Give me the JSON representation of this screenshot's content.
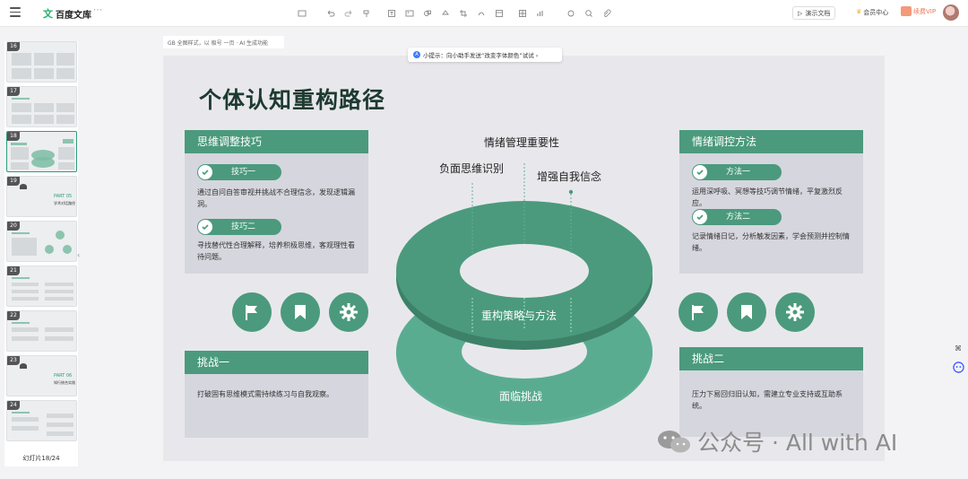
{
  "app": {
    "brand_logo": "文",
    "brand_name": "百度文库",
    "more": "⋯"
  },
  "header": {
    "present_label": "演示文档",
    "member_label": "会员中心",
    "vip_label": "续费VIP"
  },
  "toolbar": {
    "icons": [
      "image-icon",
      "undo-icon",
      "redo-icon",
      "format-painter-icon",
      "text-box-icon",
      "picture-icon",
      "shape-icon",
      "fill-icon",
      "crop-icon",
      "link-shape-icon",
      "layout-icon",
      "table-icon",
      "chart-icon",
      "more-tools-icon",
      "zoom-fit-icon",
      "search-icon",
      "attachment-icon"
    ]
  },
  "top_note": "GB 全图样式，以 极号 一页 · AI 生成功能",
  "tip": {
    "icon": "A",
    "text": "小提示：向小助手发送“改变字体颜色”试试 ›"
  },
  "sidebar": {
    "thumbs": [
      {
        "num": "16"
      },
      {
        "num": "17"
      },
      {
        "num": "18"
      },
      {
        "num": "19",
        "part": "PART  05",
        "part_sub": "学术对话路径"
      },
      {
        "num": "20"
      },
      {
        "num": "21"
      },
      {
        "num": "22"
      },
      {
        "num": "23",
        "part": "PART  06",
        "part_sub": "知行统合实践"
      },
      {
        "num": "24"
      }
    ],
    "slide_counter": "幻灯片18/24",
    "collapse": "‹"
  },
  "slide": {
    "title": "个体认知重构路径",
    "left_card": {
      "head": "思维调整技巧",
      "pill1": "技巧一",
      "text1": "通过自问自答审视并挑战不合理信念，发现逻辑漏洞。",
      "pill2": "技巧二",
      "text2": "寻找替代性合理解释，培养积极思维，客观理性看待问题。"
    },
    "right_card": {
      "head": "情绪调控方法",
      "pill1": "方法一",
      "text1": "运用深呼吸、冥想等技巧调节情绪，平复激烈反应。",
      "pill2": "方法二",
      "text2": "记录情绪日记，分析触发因素，学会预测并控制情绪。"
    },
    "challenge1": {
      "head": "挑战一",
      "text": "打破固有思维模式需持续练习与自我观察。"
    },
    "challenge2": {
      "head": "挑战二",
      "text": "压力下易回归旧认知，需建立专业支持或互助系统。"
    },
    "center": {
      "top_label": "情绪管理重要性",
      "left_label": "负面思维识别",
      "right_label": "增强自我信念",
      "upper_ring": "重构策略与方法",
      "lower_ring": "面临挑战"
    },
    "icons_left": [
      "flag-icon",
      "bookmark-icon",
      "gear-icon"
    ],
    "icons_right": [
      "flag-icon",
      "bookmark-icon",
      "gear-icon"
    ]
  },
  "watermark": "公众号 · All with AI",
  "colors": {
    "accent": "#4b9a7d",
    "accent_dark": "#3f8a6e",
    "title": "#1e3a30",
    "card": "#d6d6de",
    "slide_bg": "#e8e8ec"
  }
}
